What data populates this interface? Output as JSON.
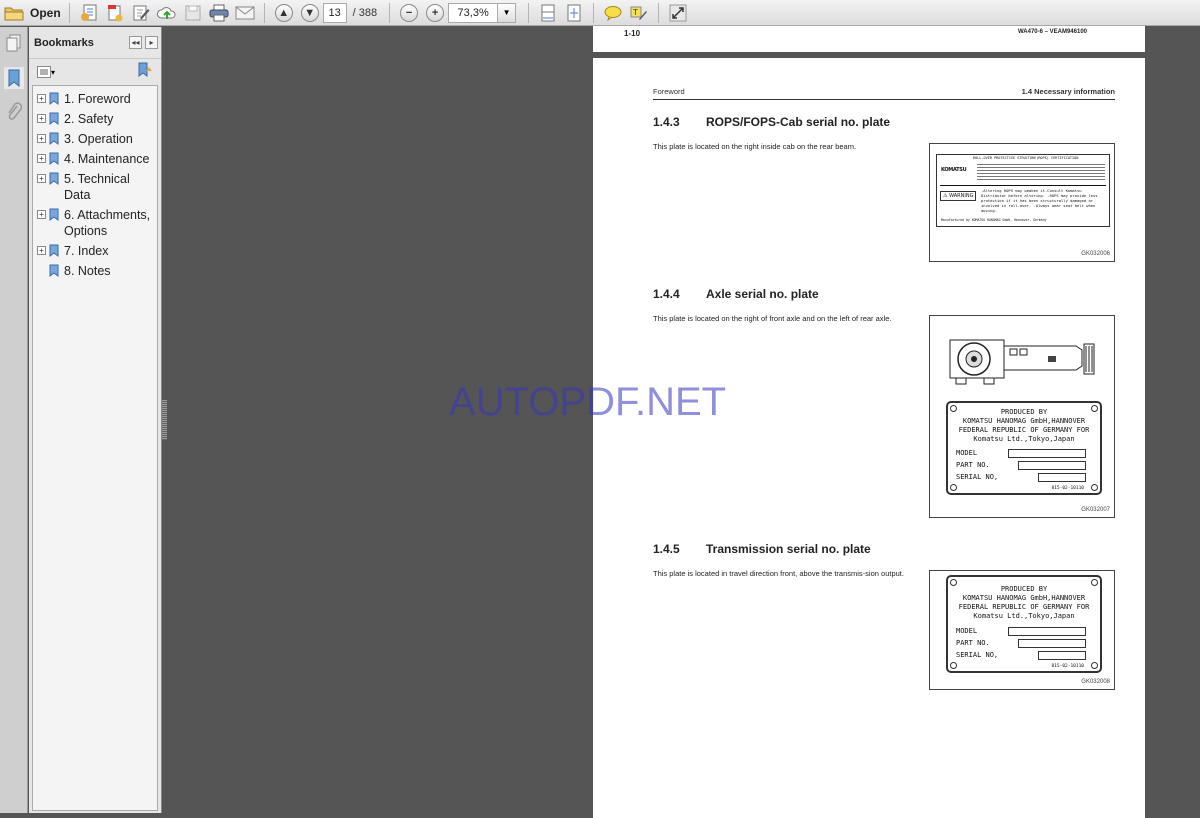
{
  "toolbar": {
    "open_label": "Open",
    "current_page": "13",
    "total_pages": "/ 388",
    "zoom_level": "73,3%",
    "icons": [
      "open-folder-icon",
      "create-pdf-icon",
      "combine-files-icon",
      "edit-pdf-icon",
      "cloud-upload-icon",
      "save-icon",
      "print-icon",
      "email-icon",
      "previous-page-icon",
      "next-page-icon",
      "zoom-out-icon",
      "zoom-in-icon",
      "fit-width-icon",
      "fit-page-icon",
      "comment-icon",
      "highlight-text-icon",
      "full-screen-icon"
    ]
  },
  "bookmarks": {
    "title": "Bookmarks",
    "items": [
      {
        "label": "1. Foreword",
        "expandable": true
      },
      {
        "label": "2. Safety",
        "expandable": true
      },
      {
        "label": "3. Operation",
        "expandable": true
      },
      {
        "label": "4. Maintenance",
        "expandable": true
      },
      {
        "label": "5. Technical Data",
        "expandable": true
      },
      {
        "label": "6. Attachments, Options",
        "expandable": true
      },
      {
        "label": "7. Index",
        "expandable": true
      },
      {
        "label": "8. Notes",
        "expandable": false
      }
    ]
  },
  "document": {
    "prev_page_number": "1-10",
    "prev_page_doc": "WA470-6 – VEAM946100",
    "running_head_left": "Foreword",
    "running_head_right": "1.4  Necessary information",
    "sections": [
      {
        "num": "1.4.3",
        "title": "ROPS/FOPS-Cab serial no. plate",
        "text": "This plate is located on the right inside cab on the rear beam.",
        "figure_code": "GK032006"
      },
      {
        "num": "1.4.4",
        "title": "Axle serial no. plate",
        "text": "This plate is located on the right of front axle and on the left of rear axle.",
        "figure_code": "GK032007"
      },
      {
        "num": "1.4.5",
        "title": "Transmission serial no. plate",
        "text": "This plate is located in travel direction front, above the transmis-sion output.",
        "figure_code": "GK032008"
      }
    ],
    "rops_plate": {
      "title": "ROLL-OVER PROTECTIVE STRUCTURE(ROPS) CERTIFICATION",
      "brand": "KOMATSU",
      "warning_label": "⚠ WARNING",
      "warning_text": ".Altering ROPS may weaken it.Consult Komatsu Distributor before altering. .ROPS may provide less protection if it has been structurally damaged or involved in roll-over. .Always wear seat belt when moving.",
      "manufacturer": "Manufactured by KOMATSU HANOMAG GmbH, Hannover, Germany"
    },
    "serial_plate": {
      "lines": [
        "PRODUCED BY",
        "KOMATSU HANOMAG GmbH,HANNOVER",
        "FEDERAL REPUBLIC OF GERMANY FOR",
        "Komatsu Ltd.,Tokyo,Japan"
      ],
      "model_label": "MODEL",
      "part_label": "PART NO.",
      "serial_label": "SERIAL NO,",
      "plate_code": "815-02-10110"
    }
  },
  "watermark": "AUTOPDF.NET"
}
